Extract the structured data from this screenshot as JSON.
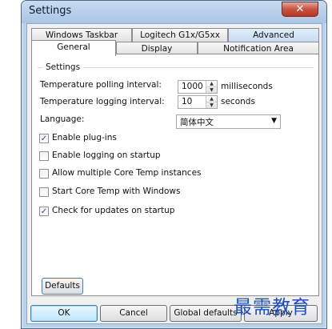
{
  "window": {
    "title": "Settings",
    "close_glyph": "✕"
  },
  "tabs_row1": [
    "Windows Taskbar",
    "Logitech G1x/G5xx",
    "Advanced"
  ],
  "tabs_row2": [
    "General",
    "Display",
    "Notification Area"
  ],
  "active_tab": "General",
  "group": {
    "label": "Settings"
  },
  "polling": {
    "label": "Temperature polling interval:",
    "value": "1000",
    "unit": "milliseconds"
  },
  "logging": {
    "label": "Temperature logging interval:",
    "value": "10",
    "unit": "seconds"
  },
  "language": {
    "label": "Language:",
    "value": "简体中文"
  },
  "checkboxes": [
    {
      "label": "Enable plug-ins",
      "checked": true
    },
    {
      "label": "Enable logging on startup",
      "checked": false
    },
    {
      "label": "Allow multiple Core Temp instances",
      "checked": false
    },
    {
      "label": "Start Core Temp with Windows",
      "checked": false
    },
    {
      "label": "Check for updates on startup",
      "checked": true
    }
  ],
  "buttons": {
    "defaults": "Defaults",
    "ok": "OK",
    "cancel": "Cancel",
    "global_defaults": "Global defaults",
    "apply": "Apply"
  },
  "watermark": "最需教育",
  "colors": {
    "frame": "#b9d1ea",
    "check": "#2a3e8c",
    "watermark": "#1a4ec9"
  }
}
